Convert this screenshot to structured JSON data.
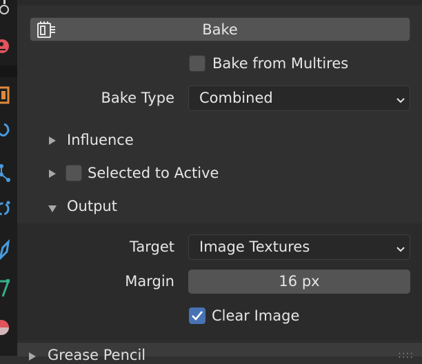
{
  "bake": {
    "button_label": "Bake"
  },
  "bake_from_multires": {
    "label": "Bake from Multires",
    "checked": false
  },
  "bake_type": {
    "label": "Bake Type",
    "value": "Combined"
  },
  "sections": {
    "influence": {
      "label": "Influence",
      "expanded": false
    },
    "selected_to_active": {
      "label": "Selected to Active",
      "expanded": false,
      "checked": false
    },
    "output": {
      "label": "Output",
      "expanded": true
    }
  },
  "output": {
    "target_label": "Target",
    "target_value": "Image Textures",
    "margin_label": "Margin",
    "margin_value": "16 px",
    "clear_image_label": "Clear Image",
    "clear_image_checked": true
  },
  "next_panel": {
    "label": "Grease Pencil"
  },
  "sidebar_icons": [
    "render-properties-icon",
    "material-icon",
    "object-properties-icon",
    "physics-icon",
    "particles-icon",
    "constraints-icon",
    "modifier-icon",
    "object-data-icon",
    "shading-icon"
  ],
  "colors": {
    "accent": "#4772b3",
    "icon_blue": "#4a9be0",
    "icon_orange": "#e08a3a",
    "icon_red": "#e0545a",
    "icon_teal": "#33b08a"
  }
}
